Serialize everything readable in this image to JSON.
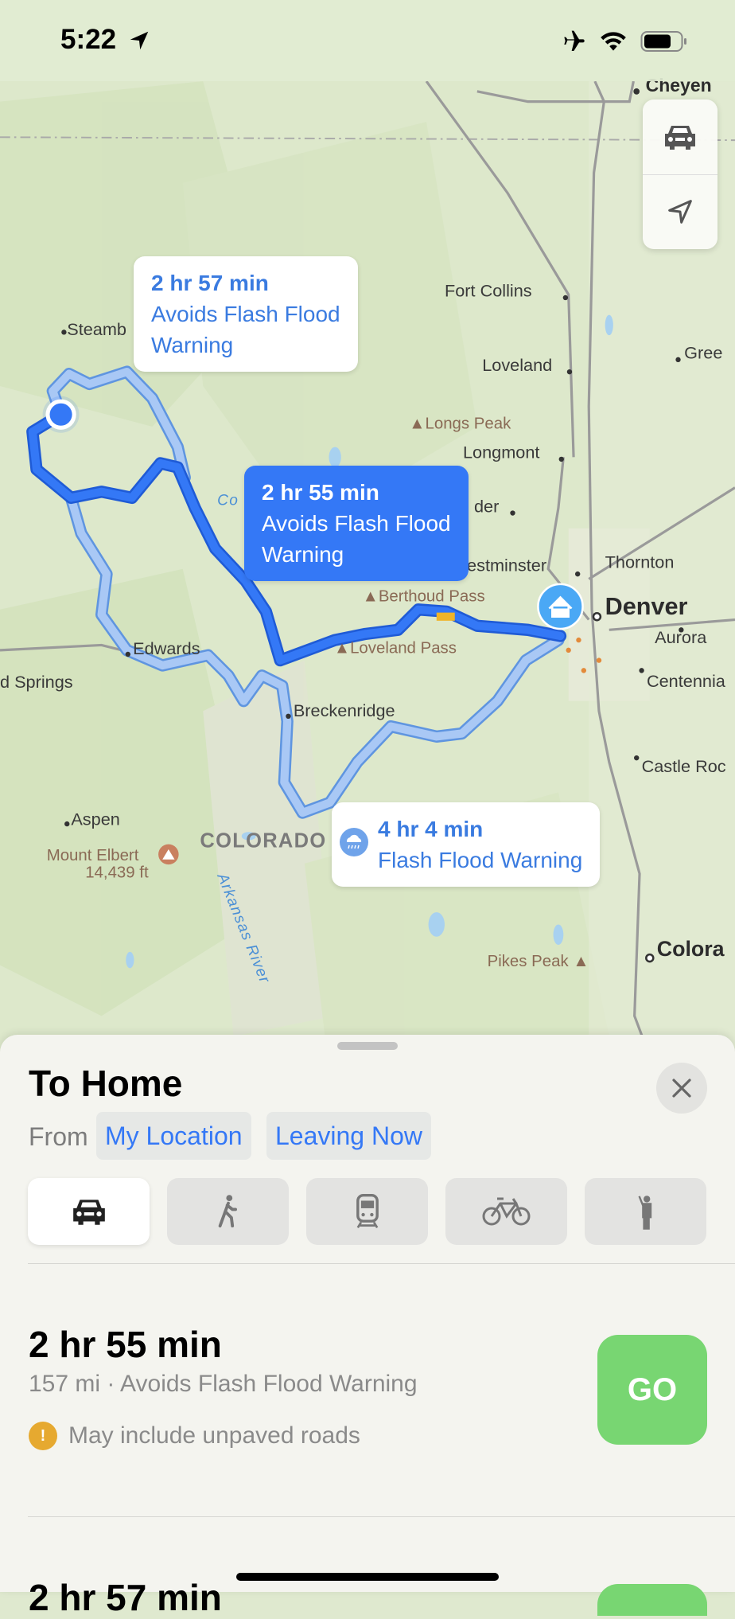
{
  "status_bar": {
    "time": "5:22",
    "icons": [
      "location-arrow-icon",
      "airplane-icon",
      "wifi-icon",
      "battery-icon"
    ]
  },
  "map": {
    "labels": {
      "cheyenne": "Cheyen",
      "fort_collins": "Fort Collins",
      "loveland": "Loveland",
      "greeley": "Gree",
      "longs_peak": "Longs Peak",
      "longmont": "Longmont",
      "boulder": "der",
      "westminster": "estminster",
      "thornton": "Thornton",
      "denver": "Denver",
      "aurora": "Aurora",
      "centennial": "Centennia",
      "castle_rock": "Castle Roc",
      "colorado_springs": "Colora",
      "pikes_peak": "Pikes Peak",
      "steamboat": "Steamb",
      "co": "Co",
      "berthoud_pass": "Berthoud Pass",
      "loveland_pass": "Loveland Pass",
      "edwards": "Edwards",
      "glenwood": "d Springs",
      "breckenridge": "Breckenridge",
      "aspen": "Aspen",
      "mount_elbert": "Mount Elbert",
      "mount_elbert_elev": "14,439 ft",
      "state": "COLORADO",
      "river": "Arkansas River"
    },
    "route_color": "#3478f6",
    "alt_route_color": "#9cc0f5",
    "callouts": [
      {
        "time": "2 hr 57 min",
        "line1": "Avoids Flash Flood",
        "line2": "Warning",
        "selected": false
      },
      {
        "time": "2 hr 55 min",
        "line1": "Avoids Flash Flood",
        "line2": "Warning",
        "selected": true
      },
      {
        "time": "4 hr 4 min",
        "line1": "Flash Flood Warning",
        "icon": "rain-cloud-icon",
        "selected": false
      }
    ],
    "controls": [
      "car-icon",
      "location-arrow-icon"
    ]
  },
  "sheet": {
    "title": "To Home",
    "from_label": "From",
    "origin": "My Location",
    "departure": "Leaving Now",
    "modes": [
      {
        "name": "drive",
        "icon": "car-icon",
        "selected": true
      },
      {
        "name": "walk",
        "icon": "walk-icon",
        "selected": false
      },
      {
        "name": "transit",
        "icon": "train-icon",
        "selected": false
      },
      {
        "name": "cycle",
        "icon": "bicycle-icon",
        "selected": false
      },
      {
        "name": "ride",
        "icon": "hail-icon",
        "selected": false
      }
    ],
    "routes": [
      {
        "time": "2 hr 55 min",
        "details": "157 mi · Avoids Flash Flood Warning",
        "warning": "May include unpaved roads",
        "go_label": "GO"
      },
      {
        "time": "2 hr 57 min"
      }
    ],
    "go_color": "#78d672"
  }
}
